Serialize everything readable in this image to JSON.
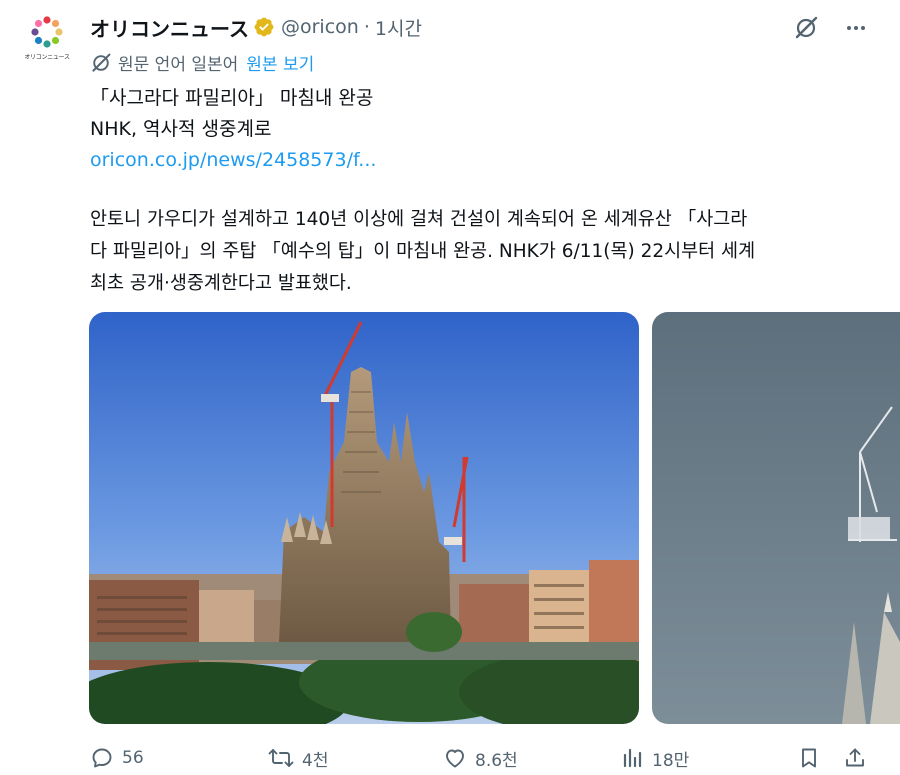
{
  "post": {
    "author_name": "オリコンニュース",
    "handle": "@oricon",
    "separator": "·",
    "time": "1시간",
    "avatar_text": "オリコンニュース"
  },
  "translation": {
    "label": "원문 언어 일본어",
    "view_original": "원본 보기"
  },
  "content": {
    "line1": "「사그라다 파밀리아」 마침내 완공",
    "line2": "NHK, 역사적 생중계로",
    "link": "oricon.co.jp/news/2458573/f...",
    "para": [
      "안토니 가우디가 설계하고 140년 이상에 걸쳐 건설이 계속되어 온 세계유산 「사그라",
      "다 파밀리아」의 주탑 「예수의 탑」이 마침내 완공. NHK가 6/11(목) 22시부터 세계",
      "최초 공개·생중계한다고 발표했다."
    ]
  },
  "actions": {
    "replies": "56",
    "reposts": "4천",
    "likes": "8.6천",
    "views": "18만"
  },
  "icons": {
    "verified": "verified-badge-icon",
    "grok": "grok-icon",
    "more": "more-icon",
    "translate": "translate-icon",
    "reply": "reply-icon",
    "repost": "repost-icon",
    "like": "like-icon",
    "views": "views-icon",
    "bookmark": "bookmark-icon",
    "share": "share-icon"
  },
  "colors": {
    "text": "#0f1419",
    "secondary": "#536471",
    "link": "#1d9bf0",
    "verified": "#e2b719"
  }
}
